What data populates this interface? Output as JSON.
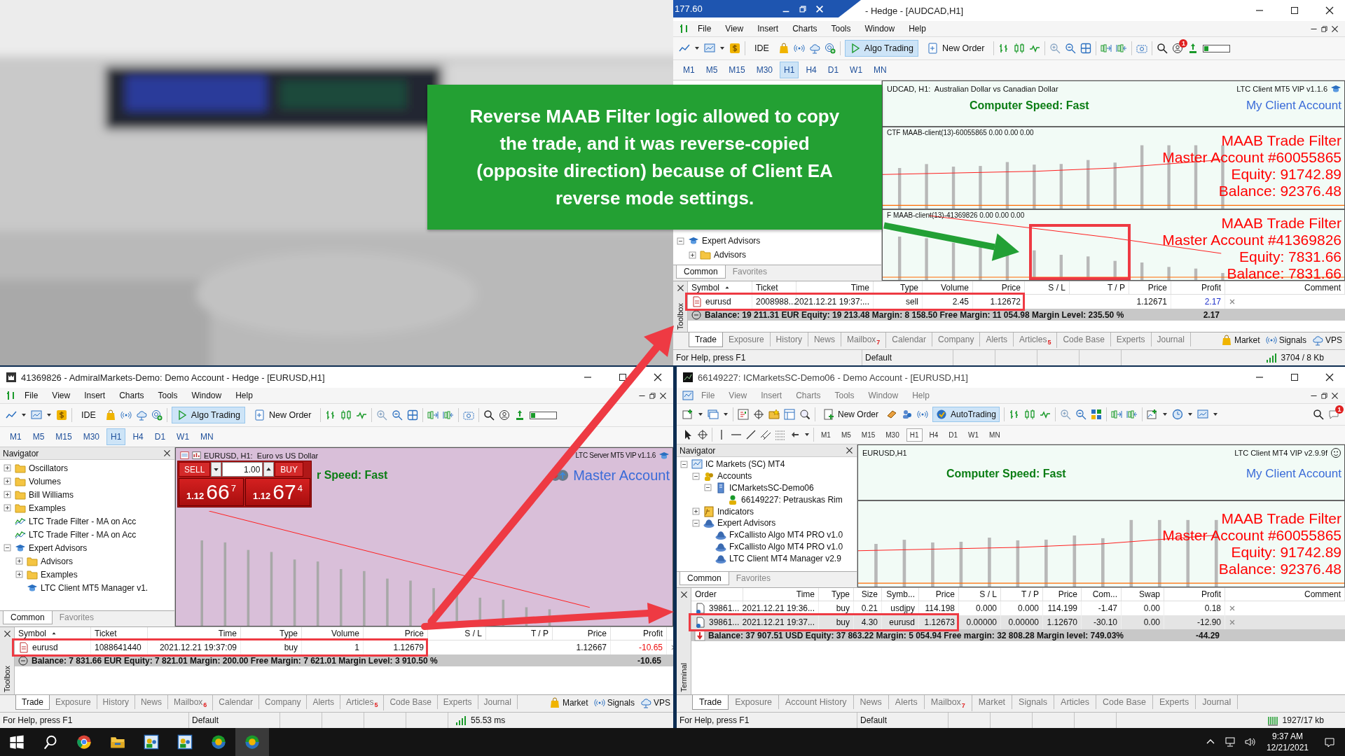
{
  "callout": {
    "text": "Reverse MAAB Filter logic allowed to copy the trade, and it was reverse-copied (opposite direction) because of Client EA reverse mode settings."
  },
  "windows": [
    {
      "kind": "mt5",
      "title": "- Hedge - [AUDCAD,H1]",
      "overlay_bar": {
        "text": "177.60"
      },
      "menu": [
        "File",
        "View",
        "Insert",
        "Charts",
        "Tools",
        "Window",
        "Help"
      ],
      "toolbar": [
        {
          "kind": "ide",
          "label": "IDE",
          "on": false
        },
        {
          "kind": "algo",
          "label": "Algo Trading",
          "on": true
        },
        {
          "kind": "order",
          "label": "New Order",
          "on": false
        }
      ],
      "notifications": "1",
      "timeframes": [
        {
          "label": "M1",
          "selected": false
        },
        {
          "label": "M5",
          "selected": false
        },
        {
          "label": "M15",
          "selected": false
        },
        {
          "label": "M30",
          "selected": false
        },
        {
          "label": "H1",
          "selected": true
        },
        {
          "label": "H4",
          "selected": false
        },
        {
          "label": "D1",
          "selected": false
        },
        {
          "label": "W1",
          "selected": false
        },
        {
          "label": "MN",
          "selected": false
        }
      ],
      "navigator": {
        "tree": [
          {
            "kind": "expert",
            "label": "Expert Advisors",
            "expanded": true,
            "children": [
              {
                "kind": "folder",
                "label": "Advisors",
                "expanded": false
              }
            ]
          }
        ],
        "tabs": [
          {
            "label": "Common",
            "selected": true
          },
          {
            "label": "Favorites",
            "selected": false
          }
        ]
      },
      "chart": {
        "kind": "client",
        "symbol": "UDCAD, H1:  Australian Dollar vs Canadian Dollar",
        "ea": "LTC Client MT5 VIP v1.1.6",
        "speed": "Computer Speed: Fast",
        "account": "My Client Account",
        "panels": [
          {
            "label": "CTF MAAB-client(13)-60055865 0.00 0.00 0.00",
            "highlighted": false,
            "lines": [
              "MAAB Trade Filter",
              "Master Account #60055865",
              "Equity: 91742.89",
              "Balance: 92376.48"
            ]
          },
          {
            "label": "F MAAB-client(13)-41369826 0.00 0.00 0.00",
            "highlighted": true,
            "lines": [
              "MAAB Trade Filter",
              "Master Account #41369826",
              "Equity: 7831.66",
              "Balance: 7831.66"
            ]
          }
        ]
      },
      "toolbox": {
        "label": "Toolbox",
        "columns": [
          "Symbol",
          "Ticket",
          "Time",
          "Type",
          "Volume",
          "Price",
          "S / L",
          "T / P",
          "Price",
          "Profit",
          "Comment"
        ],
        "rows": [
          {
            "selected": false,
            "highlighted": true,
            "cells": [
              "eurusd",
              "2008988...",
              "2021.12.21 19:37:...",
              "sell",
              "2.45",
              "1.12672",
              null,
              null,
              "1.12671",
              {
                "text": "2.17",
                "color": "#2233cc"
              },
              null
            ]
          }
        ],
        "balance": "Balance: 19 211.31 EUR  Equity: 19 213.48  Margin: 8 158.50  Free Margin: 11 054.98  Margin Level: 235.50 %",
        "total": "2.17"
      },
      "tabs": [
        {
          "label": "Trade",
          "selected": true
        },
        {
          "label": "Exposure",
          "selected": false
        },
        {
          "label": "History",
          "selected": false
        },
        {
          "label": "News",
          "selected": false
        },
        {
          "label": "Mailbox",
          "selected": false,
          "badge": "7"
        },
        {
          "label": "Calendar",
          "selected": false
        },
        {
          "label": "Company",
          "selected": false
        },
        {
          "label": "Alerts",
          "selected": false
        },
        {
          "label": "Articles",
          "selected": false,
          "badge": "5"
        },
        {
          "label": "Code Base",
          "selected": false
        },
        {
          "label": "Experts",
          "selected": false
        },
        {
          "label": "Journal",
          "selected": false
        }
      ],
      "extras": [
        {
          "kind": "market",
          "label": "Market"
        },
        {
          "kind": "signals",
          "label": "Signals"
        },
        {
          "kind": "vps",
          "label": "VPS"
        }
      ],
      "status": {
        "help": "For Help, press F1",
        "profile": "Default",
        "connection": "3704 / 8 Kb"
      }
    },
    {
      "kind": "mt5",
      "title": "41369826 - AdmiralMarkets-Demo: Demo Account - Hedge - [EURUSD,H1]",
      "menu": [
        "File",
        "View",
        "Insert",
        "Charts",
        "Tools",
        "Window",
        "Help"
      ],
      "toolbar": [
        {
          "kind": "ide",
          "label": "IDE",
          "on": false
        },
        {
          "kind": "algo",
          "label": "Algo Trading",
          "on": true
        },
        {
          "kind": "order",
          "label": "New Order",
          "on": false
        }
      ],
      "timeframes": [
        {
          "label": "M1",
          "selected": false
        },
        {
          "label": "M5",
          "selected": false
        },
        {
          "label": "M15",
          "selected": false
        },
        {
          "label": "M30",
          "selected": false
        },
        {
          "label": "H1",
          "selected": true
        },
        {
          "label": "H4",
          "selected": false
        },
        {
          "label": "D1",
          "selected": false
        },
        {
          "label": "W1",
          "selected": false
        },
        {
          "label": "MN",
          "selected": false
        }
      ],
      "navigator": {
        "title": "Navigator",
        "tree": [
          {
            "kind": "folder",
            "label": "Oscillators",
            "expanded": false
          },
          {
            "kind": "folder",
            "label": "Volumes",
            "expanded": false
          },
          {
            "kind": "folder",
            "label": "Bill Williams",
            "expanded": false
          },
          {
            "kind": "folder",
            "label": "Examples",
            "expanded": false
          },
          {
            "kind": "indicator",
            "label": "LTC Trade Filter - MA on Acc"
          },
          {
            "kind": "indicator",
            "label": "LTC Trade Filter - MA on Acc"
          },
          {
            "kind": "expert",
            "label": "Expert Advisors",
            "expanded": true,
            "children": [
              {
                "kind": "folder",
                "label": "Advisors",
                "expanded": false
              },
              {
                "kind": "folder",
                "label": "Examples",
                "expanded": false
              },
              {
                "kind": "expert",
                "label": "LTC Client MT5 Manager v1."
              }
            ]
          }
        ],
        "tabs": [
          {
            "label": "Common",
            "selected": true
          },
          {
            "label": "Favorites",
            "selected": false
          }
        ]
      },
      "chart": {
        "kind": "server",
        "symbol": "EURUSD, H1:  Euro vs US Dollar",
        "ea": "LTC Server MT5 VIP v1.1.6",
        "speed": "r Speed: Fast",
        "account": "Master Account",
        "trade_panel": {
          "sell": "SELL",
          "buy": "BUY",
          "volume": "1.00",
          "bid": [
            "1.12",
            "66",
            "7"
          ],
          "ask": [
            "1.12",
            "67",
            "4"
          ]
        }
      },
      "toolbox": {
        "label": "Toolbox",
        "columns": [
          "Symbol",
          "Ticket",
          "Time",
          "Type",
          "Volume",
          "Price",
          "S / L",
          "T / P",
          "Price",
          "Profit"
        ],
        "rows": [
          {
            "selected": false,
            "highlighted": true,
            "cells": [
              "eurusd",
              "1088641440",
              "2021.12.21 19:37:09",
              "buy",
              "1",
              "1.12679",
              null,
              null,
              "1.12667",
              {
                "text": "-10.65",
                "color": "#ee1111"
              }
            ]
          }
        ],
        "balance": "Balance: 7 831.66 EUR  Equity: 7 821.01  Margin: 200.00  Free Margin: 7 621.01  Margin Level: 3 910.50 %",
        "total": "-10.65"
      },
      "tabs": [
        {
          "label": "Trade",
          "selected": true
        },
        {
          "label": "Exposure",
          "selected": false
        },
        {
          "label": "History",
          "selected": false
        },
        {
          "label": "News",
          "selected": false
        },
        {
          "label": "Mailbox",
          "selected": false,
          "badge": "6"
        },
        {
          "label": "Calendar",
          "selected": false
        },
        {
          "label": "Company",
          "selected": false
        },
        {
          "label": "Alerts",
          "selected": false
        },
        {
          "label": "Articles",
          "selected": false,
          "badge": "5"
        },
        {
          "label": "Code Base",
          "selected": false
        },
        {
          "label": "Experts",
          "selected": false
        },
        {
          "label": "Journal",
          "selected": false
        }
      ],
      "extras": [
        {
          "kind": "market",
          "label": "Market"
        },
        {
          "kind": "signals",
          "label": "Signals"
        },
        {
          "kind": "vps",
          "label": "VPS"
        }
      ],
      "status": {
        "help": "For Help, press F1",
        "profile": "Default",
        "connection": "55.53 ms"
      }
    },
    {
      "kind": "mt4",
      "title": "66149227: ICMarketsSC-Demo06 - Demo Account - [EURUSD,H1]",
      "menu": [
        "File",
        "View",
        "Insert",
        "Charts",
        "Tools",
        "Window",
        "Help"
      ],
      "toolbar": [
        {
          "kind": "order",
          "label": "New Order",
          "on": false
        },
        {
          "kind": "algo",
          "label": "AutoTrading",
          "on": true
        }
      ],
      "notifications": "1",
      "timeframes": [
        {
          "label": "M1",
          "selected": false
        },
        {
          "label": "M5",
          "selected": false
        },
        {
          "label": "M15",
          "selected": false
        },
        {
          "label": "M30",
          "selected": false
        },
        {
          "label": "H1",
          "selected": true
        },
        {
          "label": "H4",
          "selected": false
        },
        {
          "label": "D1",
          "selected": false
        },
        {
          "label": "W1",
          "selected": false
        },
        {
          "label": "MN",
          "selected": false
        }
      ],
      "navigator": {
        "title": "Navigator",
        "tree": [
          {
            "kind": "terminal",
            "label": "IC Markets (SC) MT4",
            "expanded": true,
            "children": [
              {
                "kind": "accounts",
                "label": "Accounts",
                "expanded": true,
                "children": [
                  {
                    "kind": "server",
                    "label": "ICMarketsSC-Demo06",
                    "expanded": true,
                    "children": [
                      {
                        "kind": "person",
                        "label": "66149227: Petrauskas Rim"
                      }
                    ]
                  }
                ]
              },
              {
                "kind": "indicators",
                "label": "Indicators",
                "expanded": false
              },
              {
                "kind": "hat",
                "label": "Expert Advisors",
                "expanded": true,
                "children": [
                  {
                    "kind": "hat",
                    "label": "FxCallisto Algo MT4 PRO v1.0"
                  },
                  {
                    "kind": "hat",
                    "label": "FxCallisto Algo MT4 PRO v1.0"
                  },
                  {
                    "kind": "hat",
                    "label": "LTC Client MT4 Manager v2.9"
                  }
                ]
              }
            ]
          }
        ],
        "tabs": [
          {
            "label": "Common",
            "selected": true
          },
          {
            "label": "Favorites",
            "selected": false
          }
        ]
      },
      "chart": {
        "kind": "client",
        "symbol": "EURUSD,H1",
        "ea": "LTC Client MT4 VIP v2.9.9f",
        "speed": "Computer Speed: Fast",
        "account": "My Client Account",
        "panels": [
          {
            "highlighted": false,
            "lines": [
              "MAAB Trade Filter",
              "Master Account #60055865",
              "Equity: 91742.89",
              "Balance: 92376.48"
            ]
          }
        ]
      },
      "toolbox": {
        "label": "Terminal",
        "columns": [
          "Order",
          "Time",
          "Type",
          "Size",
          "Symb...",
          "Price",
          "S / L",
          "T / P",
          "Price",
          "Com...",
          "Swap",
          "Profit",
          "Comment"
        ],
        "rows": [
          {
            "selected": false,
            "highlighted": false,
            "cells": [
              "39861...",
              "2021.12.21 19:36...",
              "buy",
              "0.21",
              "usdjpy",
              "114.198",
              "0.000",
              "0.000",
              "114.199",
              "-1.47",
              "0.00",
              "0.18",
              null
            ]
          },
          {
            "selected": true,
            "highlighted": true,
            "cells": [
              "39861...",
              "2021.12.21 19:37...",
              "buy",
              "4.30",
              "eurusd",
              "1.12673",
              "0.00000",
              "0.00000",
              "1.12670",
              "-30.10",
              "0.00",
              "-12.90",
              null
            ]
          }
        ],
        "balance": "Balance: 37 907.51 USD  Equity: 37 863.22  Margin: 5 054.94  Free margin: 32 808.28  Margin level: 749.03%",
        "total": "-44.29"
      },
      "tabs": [
        {
          "label": "Trade",
          "selected": true
        },
        {
          "label": "Exposure",
          "selected": false
        },
        {
          "label": "Account History",
          "selected": false
        },
        {
          "label": "News",
          "selected": false
        },
        {
          "label": "Alerts",
          "selected": false
        },
        {
          "label": "Mailbox",
          "selected": false,
          "badge": "7"
        },
        {
          "label": "Market",
          "selected": false
        },
        {
          "label": "Signals",
          "selected": false
        },
        {
          "label": "Articles",
          "selected": false
        },
        {
          "label": "Code Base",
          "selected": false
        },
        {
          "label": "Experts",
          "selected": false
        },
        {
          "label": "Journal",
          "selected": false
        }
      ],
      "status": {
        "help": "For Help, press F1",
        "profile": "Default",
        "connection": "1927/17 kb"
      }
    }
  ],
  "taskbar": {
    "apps": [
      {
        "kind": "browser",
        "selected": false
      },
      {
        "kind": "folder",
        "selected": false
      },
      {
        "kind": "people",
        "selected": false
      },
      {
        "kind": "people",
        "selected": false
      },
      {
        "kind": "coin",
        "selected": false
      },
      {
        "kind": "coin",
        "selected": true
      }
    ],
    "time": "9:37 AM",
    "date": "12/21/2021"
  }
}
